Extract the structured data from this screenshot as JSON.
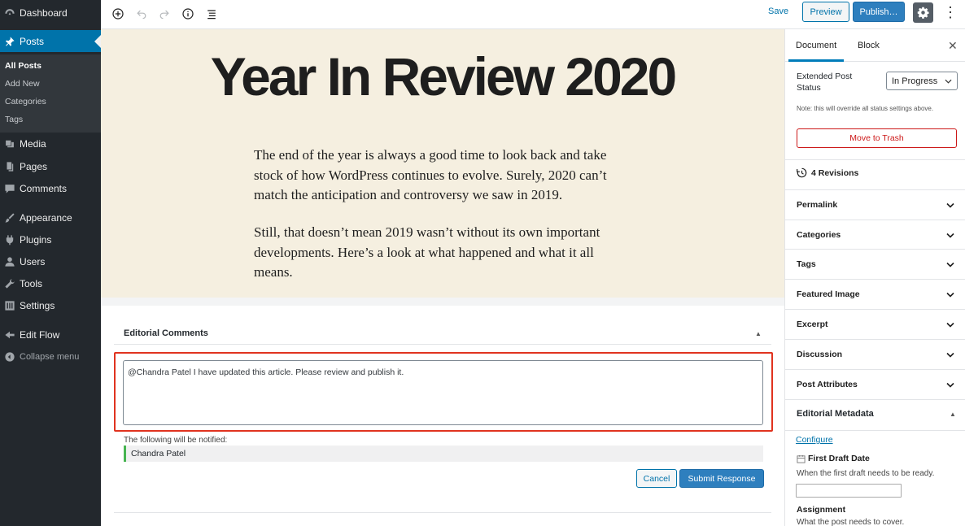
{
  "admin_menu": {
    "dashboard": "Dashboard",
    "posts": "Posts",
    "posts_submenu": [
      "All Posts",
      "Add New",
      "Categories",
      "Tags"
    ],
    "media": "Media",
    "pages": "Pages",
    "comments": "Comments",
    "appearance": "Appearance",
    "plugins": "Plugins",
    "users": "Users",
    "tools": "Tools",
    "settings": "Settings",
    "edit_flow": "Edit Flow",
    "collapse": "Collapse menu"
  },
  "toolbar": {
    "save": "Save",
    "preview": "Preview",
    "publish": "Publish…",
    "more": "⋮"
  },
  "post": {
    "title": "Year In Review 2020",
    "paragraphs": [
      "The end of the year is always a good time to look back and take stock of how WordPress continues to evolve. Surely, 2020 can’t match the anticipation and controversy we saw in 2019.",
      "Still, that doesn’t mean 2019 wasn’t without its own important developments. Here’s a look at what happened and what it all means."
    ]
  },
  "editorial_comments": {
    "title": "Editorial Comments",
    "toggle": "▲",
    "comment_text": "@Chandra Patel I have updated this article. Please review and publish it.",
    "notify_label": "The following will be notified:",
    "notify_user": "Chandra Patel",
    "cancel": "Cancel",
    "submit": "Submit Response"
  },
  "settings_sidebar": {
    "tabs": [
      "Document",
      "Block"
    ],
    "close": "✕",
    "extended_status_label": "Extended Post Status",
    "extended_status_value": "In Progress",
    "extended_status_note": "Note: this will override all status settings above.",
    "move_to_trash": "Move to Trash",
    "revisions": "4 Revisions",
    "panels": [
      "Permalink",
      "Categories",
      "Tags",
      "Featured Image",
      "Excerpt",
      "Discussion",
      "Post Attributes"
    ],
    "editorial_metadata": {
      "title": "Editorial Metadata",
      "toggle": "▲",
      "configure": "Configure",
      "first_draft_date": "First Draft Date",
      "first_draft_help": "When the first draft needs to be ready.",
      "assignment": "Assignment",
      "assignment_help": "What the post needs to cover."
    }
  },
  "colors": {
    "admin_bg": "#23282d",
    "accent": "#0073aa",
    "canvas_bg": "#f5efe0",
    "highlight": "#e0331f",
    "trash": "#cc1818"
  }
}
